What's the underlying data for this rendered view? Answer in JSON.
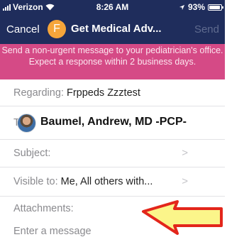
{
  "status_bar": {
    "carrier": "Verizon",
    "time": "8:26 AM",
    "battery": "93%"
  },
  "nav": {
    "cancel_label": "Cancel",
    "avatar_initial": "F",
    "title": "Get Medical Adv...",
    "send_label": "Send"
  },
  "banner": {
    "text": "Send a non-urgent message to your pediatrician's office. Expect a response within 2 business days."
  },
  "form": {
    "regarding": {
      "label": "Regarding:",
      "value": "Frppeds Zzztest"
    },
    "to": {
      "label": "T",
      "value": "Baumel, Andrew, MD -PCP-"
    },
    "subject": {
      "label": "Subject:",
      "chevron": ">"
    },
    "visible_to": {
      "label": "Visible to:",
      "value": "Me, All others with...",
      "chevron": ">"
    },
    "attachments": {
      "label": "Attachments:"
    },
    "message": {
      "placeholder": "Enter a message"
    }
  },
  "annotation": {
    "arrow_fill": "#fbf58a",
    "arrow_stroke": "#e3261b"
  },
  "colors": {
    "nav_bg": "#1f2d5c",
    "banner_bg": "#d54a86",
    "avatar_bg": "#f6a53a"
  }
}
